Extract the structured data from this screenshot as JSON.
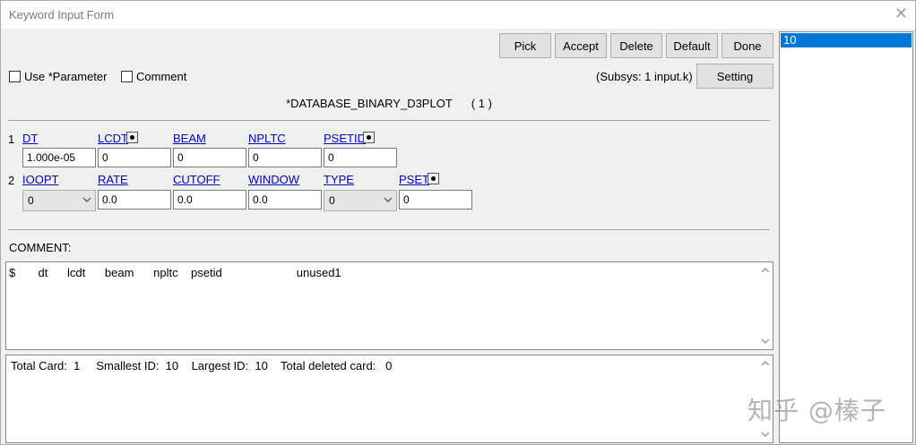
{
  "window": {
    "title": "Keyword Input Form",
    "close_glyph": "✕"
  },
  "toolbar": {
    "pick": "Pick",
    "accept": "Accept",
    "delete": "Delete",
    "default": "Default",
    "done": "Done",
    "setting": "Setting"
  },
  "options": {
    "use_parameter": "Use *Parameter",
    "use_parameter_checked": false,
    "comment": "Comment",
    "comment_checked": false
  },
  "subsys": "(Subsys: 1 input.k)",
  "keyword": {
    "name": "*DATABASE_BINARY_D3PLOT",
    "index": "( 1 )"
  },
  "cards": {
    "row1": {
      "num": "1",
      "fields": [
        {
          "label": "DT",
          "value": "1.000e-05"
        },
        {
          "label": "LCDT",
          "value": "0"
        },
        {
          "label": "BEAM",
          "value": "0"
        },
        {
          "label": "NPLTC",
          "value": "0"
        },
        {
          "label": "PSETID",
          "value": "0"
        }
      ]
    },
    "row2": {
      "num": "2",
      "fields": [
        {
          "label": "IOOPT",
          "value": "0"
        },
        {
          "label": "RATE",
          "value": "0.0"
        },
        {
          "label": "CUTOFF",
          "value": "0.0"
        },
        {
          "label": "WINDOW",
          "value": "0.0"
        },
        {
          "label": "TYPE",
          "value": "0"
        },
        {
          "label": "PSET",
          "value": "0"
        }
      ]
    }
  },
  "comment": {
    "label": "COMMENT:",
    "line": "$       dt      lcdt      beam      npltc    psetid                       unused1"
  },
  "summary": "Total Card:  1     Smallest ID:  10    Largest ID:  10    Total deleted card:   0",
  "id_list": {
    "items": [
      "10"
    ]
  },
  "watermark": "知乎 @榛子",
  "colors": {
    "selection": "#0078d7",
    "field_label": "#0000cc",
    "face": "#f0f0f0"
  }
}
